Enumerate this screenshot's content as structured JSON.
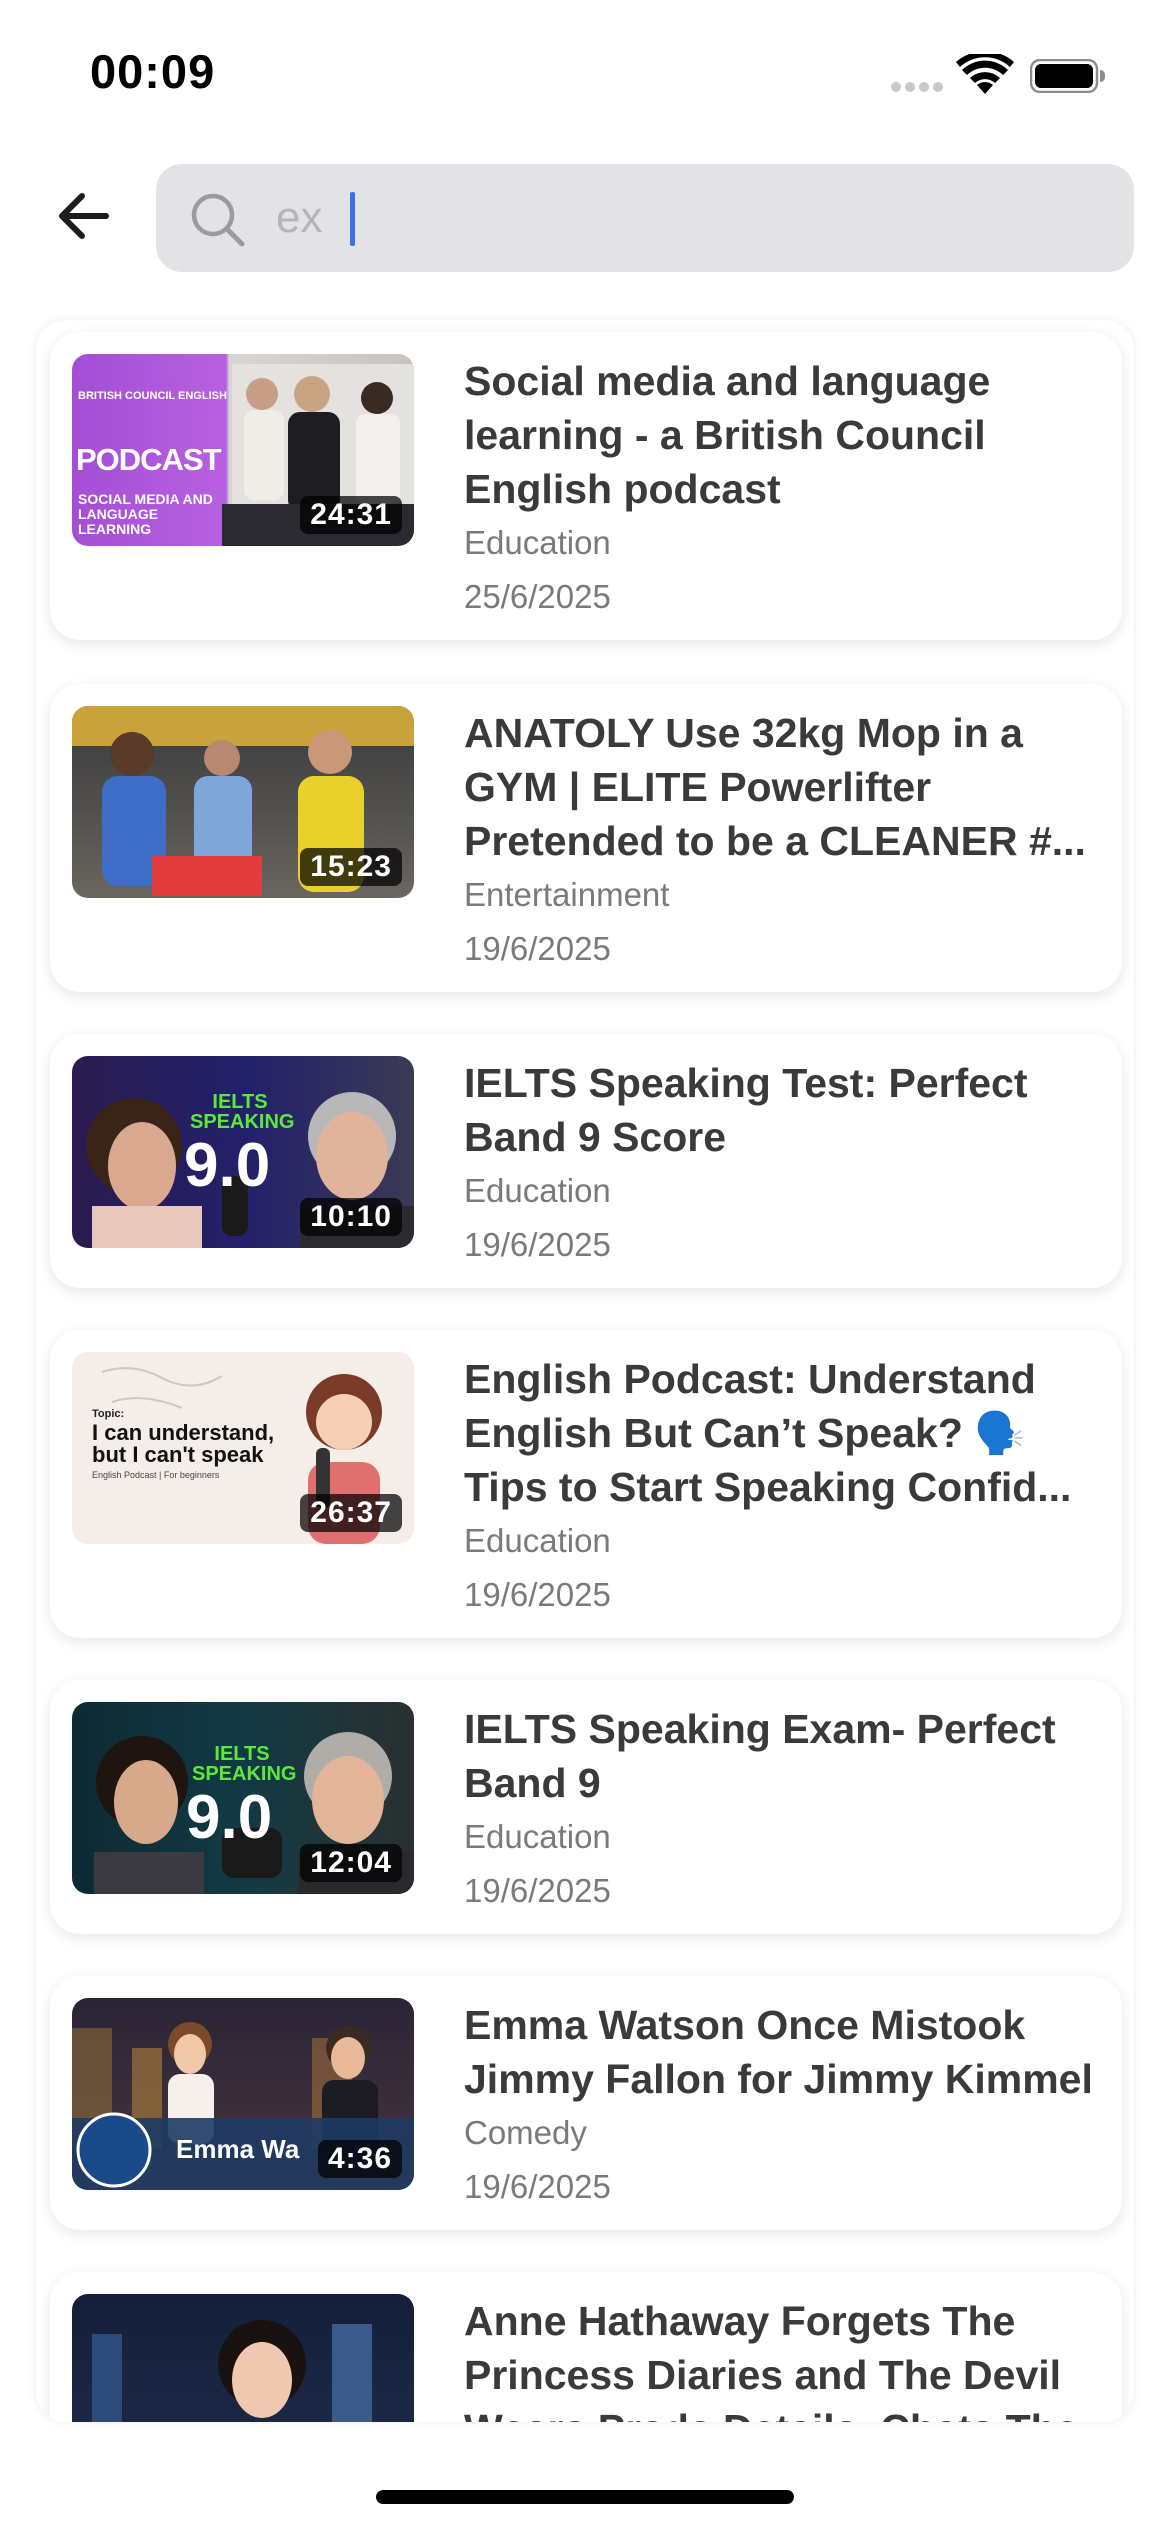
{
  "status_bar": {
    "time": "00:09"
  },
  "search": {
    "value": "ex"
  },
  "videos": [
    {
      "title": "Social media and language learning - a British Council English podcast",
      "category": "Education",
      "date": "25/6/2025",
      "duration": "24:31",
      "thumb_texts": [
        "BRITISH COUNCIL ENGLISH",
        "PODCAST",
        "SOCIAL MEDIA AND LANGUAGE LEARNING"
      ]
    },
    {
      "title": "ANATOLY Use 32kg Mop in a GYM | ELITE Powerlifter Pretended to be a CLEANER #...",
      "category": "Entertainment",
      "date": "19/6/2025",
      "duration": "15:23"
    },
    {
      "title": "IELTS Speaking Test: Perfect Band 9 Score",
      "category": "Education",
      "date": "19/6/2025",
      "duration": "10:10",
      "thumb_texts": [
        "IELTS SPEAKING",
        "9.0"
      ]
    },
    {
      "title": "English Podcast: Understand English But Can’t Speak? 🗣️ Tips to Start Speaking Confid...",
      "category": "Education",
      "date": "19/6/2025",
      "duration": "26:37",
      "thumb_texts": [
        "Topic:",
        "I can understand, but I can't speak",
        "English Podcast | For beginners"
      ]
    },
    {
      "title": "IELTS Speaking Exam- Perfect Band 9",
      "category": "Education",
      "date": "19/6/2025",
      "duration": "12:04",
      "thumb_texts": [
        "IELTS SPEAKING",
        "9.0"
      ]
    },
    {
      "title": "Emma Watson Once Mistook Jimmy Fallon for Jimmy Kimmel",
      "category": "Comedy",
      "date": "19/6/2025",
      "duration": "4:36",
      "thumb_texts": [
        "Emma Wa"
      ]
    },
    {
      "title": "Anne Hathaway Forgets The Princess Diaries and The Devil Wears Prada Details, Chats The"
    }
  ]
}
